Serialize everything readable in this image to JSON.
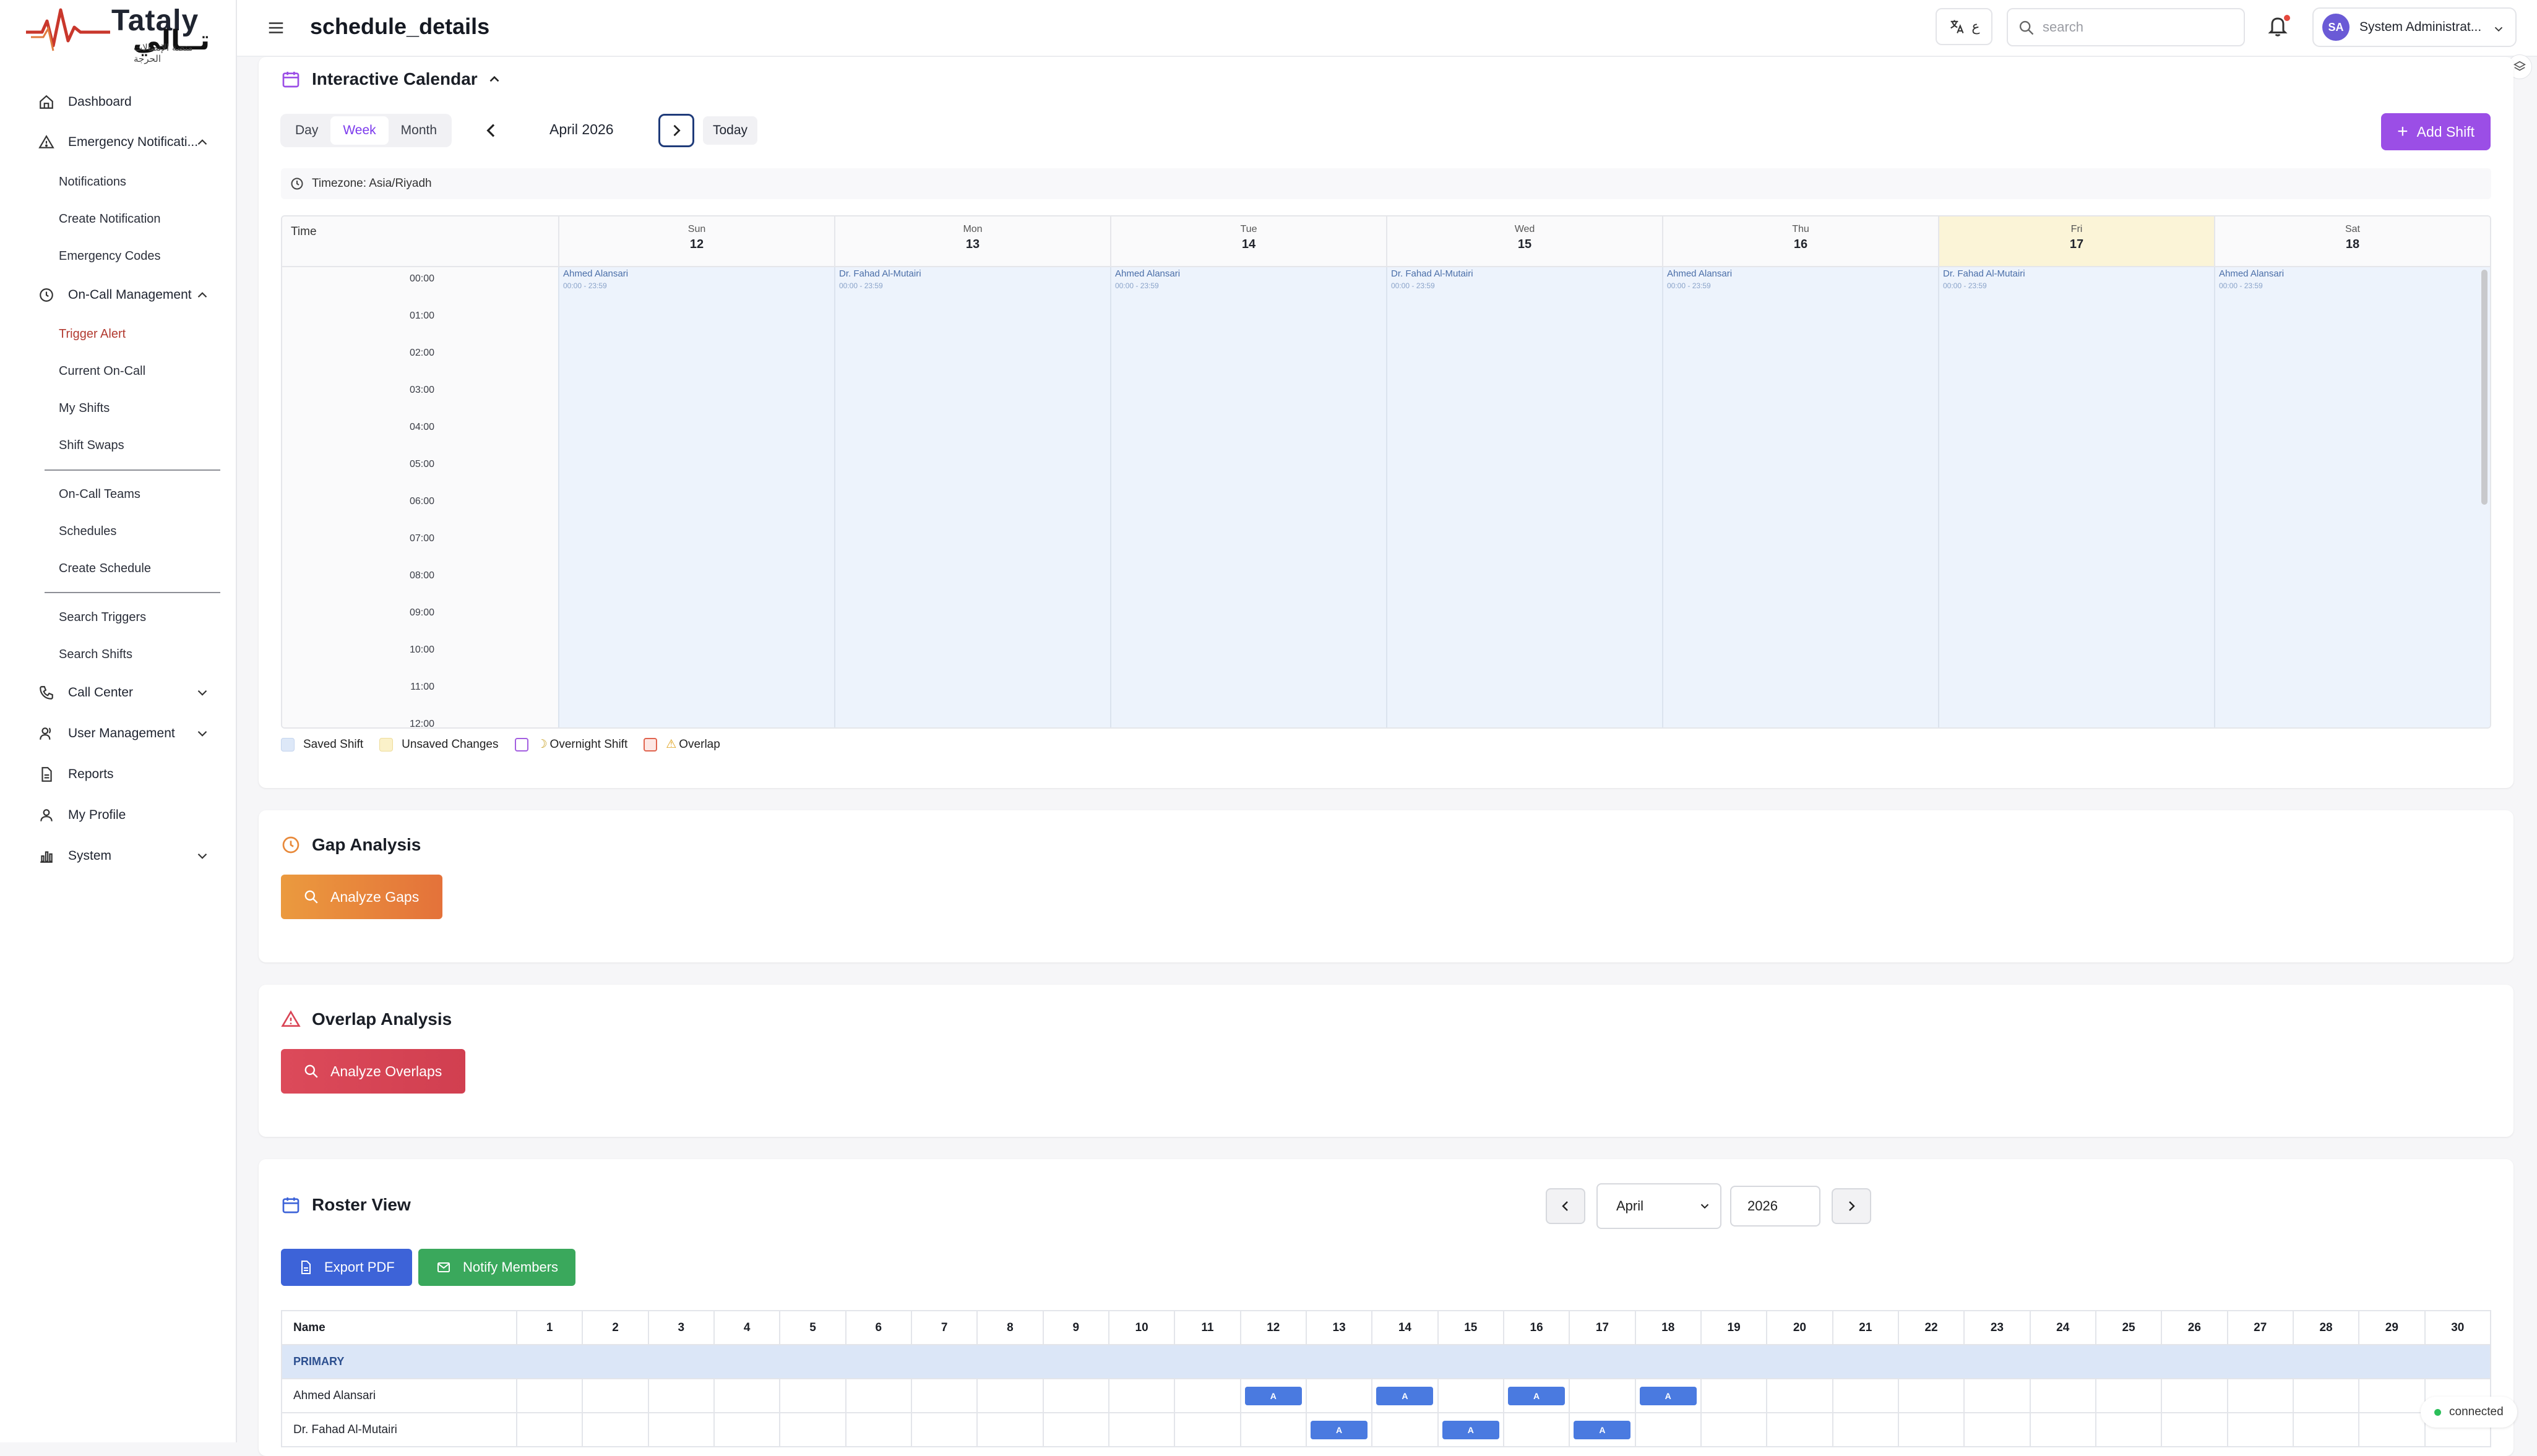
{
  "app": {
    "brand": "Tataly",
    "brand_arabic": "تــالي",
    "brand_sub": "منصة الإتصالات الحرجة",
    "page_title": "schedule_details"
  },
  "topbar": {
    "lang_label": "ع",
    "search_placeholder": "search",
    "user_initials": "SA",
    "user_name": "System Administrat..."
  },
  "sidebar": {
    "dashboard": "Dashboard",
    "emergency": "Emergency Notificati...",
    "notifications": "Notifications",
    "create_notification": "Create Notification",
    "emergency_codes": "Emergency Codes",
    "oncall": "On-Call Management",
    "trigger_alert": "Trigger Alert",
    "current_oncall": "Current On-Call",
    "my_shifts": "My Shifts",
    "shift_swaps": "Shift Swaps",
    "oncall_teams": "On-Call Teams",
    "schedules": "Schedules",
    "create_schedule": "Create Schedule",
    "search_triggers": "Search Triggers",
    "search_shifts": "Search Shifts",
    "call_center": "Call Center",
    "user_management": "User Management",
    "reports": "Reports",
    "my_profile": "My Profile",
    "system": "System"
  },
  "calendar": {
    "title": "Interactive Calendar",
    "views": [
      "Day",
      "Week",
      "Month"
    ],
    "active_view": "Week",
    "period": "April 2026",
    "today_label": "Today",
    "add_shift_label": "Add Shift",
    "timezone": "Timezone: Asia/Riyadh",
    "time_header": "Time",
    "days": [
      {
        "name": "Sun",
        "date": "12",
        "shift": "Ahmed Alansari",
        "time": "00:00 - 23:59"
      },
      {
        "name": "Mon",
        "date": "13",
        "shift": "Dr. Fahad Al-Mutairi",
        "time": "00:00 - 23:59"
      },
      {
        "name": "Tue",
        "date": "14",
        "shift": "Ahmed Alansari",
        "time": "00:00 - 23:59"
      },
      {
        "name": "Wed",
        "date": "15",
        "shift": "Dr. Fahad Al-Mutairi",
        "time": "00:00 - 23:59"
      },
      {
        "name": "Thu",
        "date": "16",
        "shift": "Ahmed Alansari",
        "time": "00:00 - 23:59"
      },
      {
        "name": "Fri",
        "date": "17",
        "shift": "Dr. Fahad Al-Mutairi",
        "time": "00:00 - 23:59"
      },
      {
        "name": "Sat",
        "date": "18",
        "shift": "Ahmed Alansari",
        "time": "00:00 - 23:59"
      }
    ],
    "highlight_day": "Fri",
    "hours": [
      "00:00",
      "01:00",
      "02:00",
      "03:00",
      "04:00",
      "05:00",
      "06:00",
      "07:00",
      "08:00",
      "09:00",
      "10:00",
      "11:00",
      "12:00"
    ],
    "legend": {
      "saved": "Saved Shift",
      "unsaved": "Unsaved Changes",
      "overnight": "Overnight Shift",
      "overlap": "Overlap"
    }
  },
  "gap": {
    "title": "Gap Analysis",
    "button": "Analyze Gaps"
  },
  "overlap": {
    "title": "Overlap Analysis",
    "button": "Analyze Overlaps"
  },
  "roster": {
    "title": "Roster View",
    "month": "April",
    "year": "2026",
    "export_label": "Export PDF",
    "notify_label": "Notify Members",
    "name_header": "Name",
    "days": [
      "1",
      "2",
      "3",
      "4",
      "5",
      "6",
      "7",
      "8",
      "9",
      "10",
      "11",
      "12",
      "13",
      "14",
      "15",
      "16",
      "17",
      "18",
      "19",
      "20",
      "21",
      "22",
      "23",
      "24",
      "25",
      "26",
      "27",
      "28",
      "29",
      "30"
    ],
    "group": "PRIMARY",
    "members": [
      {
        "name": "Ahmed Alansari",
        "marks": {
          "12": "A",
          "14": "A",
          "16": "A",
          "18": "A"
        }
      },
      {
        "name": "Dr. Fahad Al-Mutairi",
        "marks": {
          "13": "A",
          "15": "A",
          "17": "A"
        }
      }
    ]
  },
  "status": {
    "connection": "connected"
  },
  "colors": {
    "accent": "#9b4ee6",
    "active_nav": "#b23a30",
    "shift_bg": "#edf3fc",
    "pill": "#4a7ae0",
    "gap_btn": "#e8893a",
    "overlap_btn": "#d94455",
    "export_btn": "#3d63d8",
    "notify_btn": "#3aa85c"
  }
}
